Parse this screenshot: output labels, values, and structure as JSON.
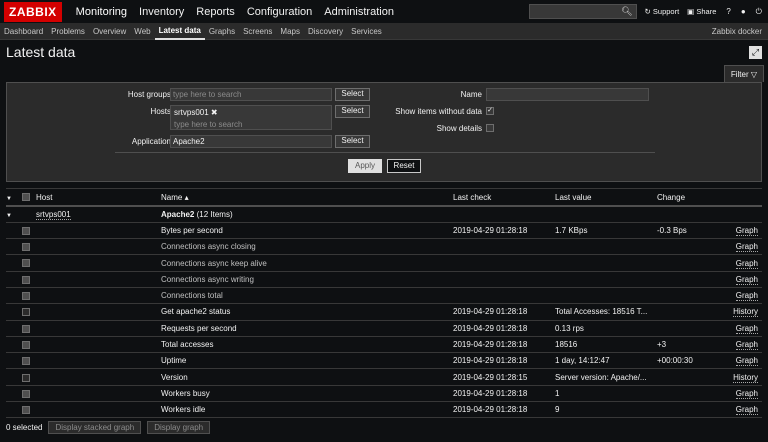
{
  "header": {
    "logo": "ZABBIX",
    "menu": [
      "Monitoring",
      "Inventory",
      "Reports",
      "Configuration",
      "Administration"
    ],
    "support": "Support",
    "share": "Share",
    "help_glyph": "?"
  },
  "submenu": {
    "items": [
      "Dashboard",
      "Problems",
      "Overview",
      "Web",
      "Latest data",
      "Graphs",
      "Screens",
      "Maps",
      "Discovery",
      "Services"
    ],
    "server": "Zabbix docker"
  },
  "page": {
    "title": "Latest data"
  },
  "filter": {
    "tab_label": "Filter",
    "host_groups_label": "Host groups",
    "host_groups_placeholder": "type here to search",
    "hosts_label": "Hosts",
    "hosts_tag": "srtvps001",
    "hosts_placeholder": "type here to search",
    "application_label": "Application",
    "application_value": "Apache2",
    "select_label": "Select",
    "name_label": "Name",
    "show_without_data_label": "Show items without data",
    "show_details_label": "Show details",
    "apply_label": "Apply",
    "reset_label": "Reset"
  },
  "table": {
    "headers": {
      "host": "Host",
      "name": "Name ▴",
      "last_check": "Last check",
      "last_value": "Last value",
      "change": "Change"
    },
    "host_name": "srtvps001",
    "app_label": "Apache2",
    "app_count": "(12 Items)",
    "rows": [
      {
        "name": "Bytes per second",
        "last_check": "2019-04-29 01:28:18",
        "last_value": "1.7 KBps",
        "change": "-0.3 Bps",
        "action": "Graph",
        "dim": false
      },
      {
        "name": "Connections async closing",
        "last_check": "",
        "last_value": "",
        "change": "",
        "action": "Graph",
        "dim": true
      },
      {
        "name": "Connections async keep alive",
        "last_check": "",
        "last_value": "",
        "change": "",
        "action": "Graph",
        "dim": true
      },
      {
        "name": "Connections async writing",
        "last_check": "",
        "last_value": "",
        "change": "",
        "action": "Graph",
        "dim": true
      },
      {
        "name": "Connections total",
        "last_check": "",
        "last_value": "",
        "change": "",
        "action": "Graph",
        "dim": true
      },
      {
        "name": "Get apache2 status",
        "last_check": "2019-04-29 01:28:18",
        "last_value": "Total Accesses: 18516 T...",
        "change": "",
        "action": "History",
        "dim": false
      },
      {
        "name": "Requests per second",
        "last_check": "2019-04-29 01:28:18",
        "last_value": "0.13 rps",
        "change": "",
        "action": "Graph",
        "dim": false
      },
      {
        "name": "Total accesses",
        "last_check": "2019-04-29 01:28:18",
        "last_value": "18516",
        "change": "+3",
        "action": "Graph",
        "dim": false
      },
      {
        "name": "Uptime",
        "last_check": "2019-04-29 01:28:18",
        "last_value": "1 day, 14:12:47",
        "change": "+00:00:30",
        "action": "Graph",
        "dim": false
      },
      {
        "name": "Version",
        "last_check": "2019-04-29 01:28:15",
        "last_value": "Server version: Apache/...",
        "change": "",
        "action": "History",
        "dim": false
      },
      {
        "name": "Workers busy",
        "last_check": "2019-04-29 01:28:18",
        "last_value": "1",
        "change": "",
        "action": "Graph",
        "dim": false
      },
      {
        "name": "Workers idle",
        "last_check": "2019-04-29 01:28:18",
        "last_value": "9",
        "change": "",
        "action": "Graph",
        "dim": false
      }
    ]
  },
  "footer": {
    "selected": "0 selected",
    "btn_stacked": "Display stacked graph",
    "btn_graph": "Display graph"
  }
}
